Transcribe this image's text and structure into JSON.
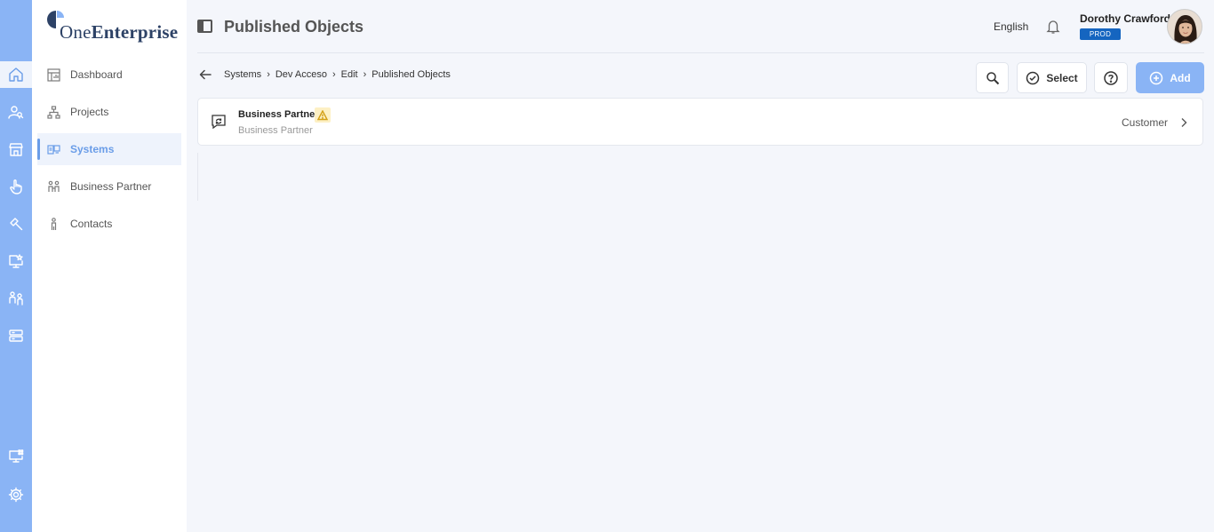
{
  "app": {
    "logo_part1": "One",
    "logo_part2": "Enterprise"
  },
  "rail": {
    "icons": [
      "home-icon",
      "user-search-icon",
      "store-icon",
      "hand-pointer-icon",
      "hammer-icon",
      "monitor-star-icon",
      "users-icon",
      "server-icon",
      "monitor-grid-icon",
      "gear-icon"
    ]
  },
  "sidebar": {
    "items": [
      {
        "label": "Dashboard",
        "icon": "dashboard-icon"
      },
      {
        "label": "Projects",
        "icon": "hierarchy-icon"
      },
      {
        "label": "Systems",
        "icon": "systems-icon",
        "active": true
      },
      {
        "label": "Business Partner",
        "icon": "people-icon"
      },
      {
        "label": "Contacts",
        "icon": "person-icon"
      }
    ]
  },
  "header": {
    "title": "Published Objects",
    "language": "English",
    "user_name": "Dorothy Crawford",
    "env_badge": "PROD"
  },
  "breadcrumb": {
    "items": [
      "Systems",
      "Dev Acceso",
      "Edit",
      "Published Objects"
    ]
  },
  "toolbar": {
    "select_label": "Select",
    "add_label": "Add"
  },
  "objects": [
    {
      "title": "Business Partner",
      "subtitle": "Business Partner",
      "type": "Customer",
      "warning": true
    }
  ],
  "colors": {
    "accent": "#8ab4f5",
    "active": "#6a9de8",
    "badge": "#1565c0",
    "warning": "#d4a017"
  }
}
